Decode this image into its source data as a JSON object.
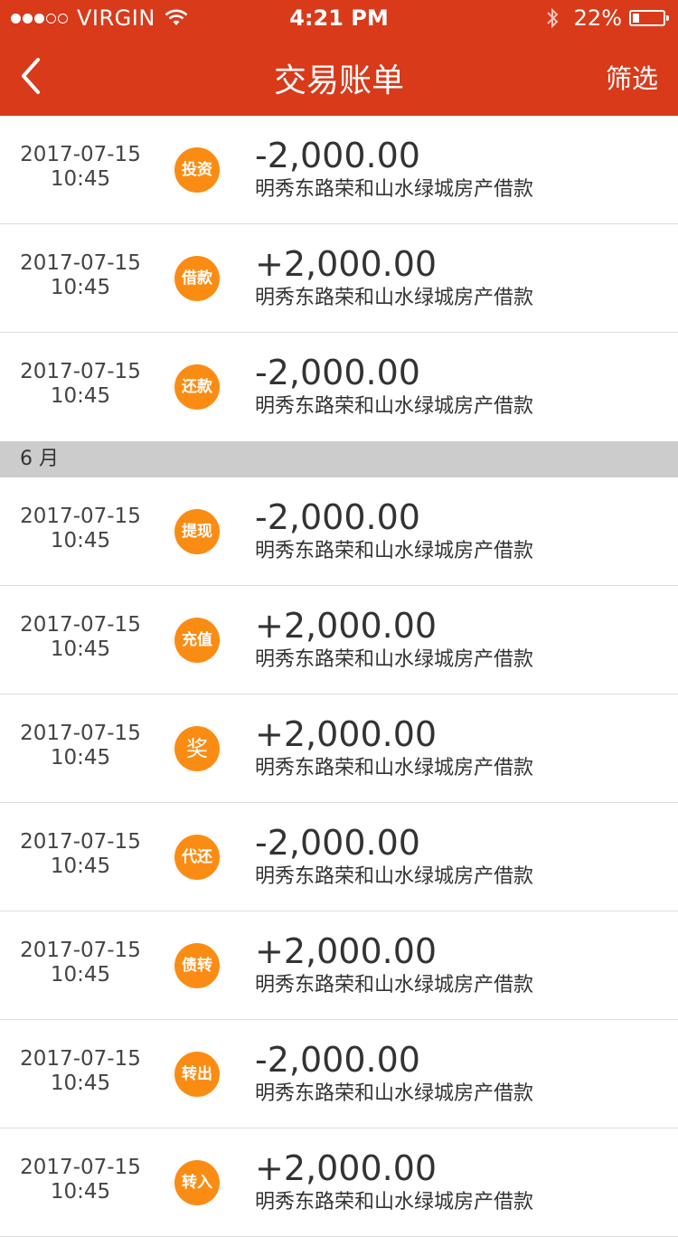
{
  "status_bar": {
    "carrier": "VIRGIN",
    "signal": {
      "filled": 3,
      "total": 5
    },
    "time": "4:21 PM",
    "battery_text": "22%",
    "battery_level": 0.22
  },
  "nav": {
    "title": "交易账单",
    "filter_label": "筛选"
  },
  "colors": {
    "header": "#d83a1a",
    "badge": "#fb8c13",
    "section": "#cccccc"
  },
  "transactions_top": [
    {
      "date": "2017-07-15",
      "time": "10:45",
      "badge": "投资",
      "amount": "-2,000.00",
      "desc": "明秀东路荣和山水绿城房产借款"
    },
    {
      "date": "2017-07-15",
      "time": "10:45",
      "badge": "借款",
      "amount": "+2,000.00",
      "desc": "明秀东路荣和山水绿城房产借款"
    },
    {
      "date": "2017-07-15",
      "time": "10:45",
      "badge": "还款",
      "amount": "-2,000.00",
      "desc": "明秀东路荣和山水绿城房产借款"
    }
  ],
  "section_label": "6 月",
  "transactions_june": [
    {
      "date": "2017-07-15",
      "time": "10:45",
      "badge": "提现",
      "amount": "-2,000.00",
      "desc": "明秀东路荣和山水绿城房产借款"
    },
    {
      "date": "2017-07-15",
      "time": "10:45",
      "badge": "充值",
      "amount": "+2,000.00",
      "desc": "明秀东路荣和山水绿城房产借款"
    },
    {
      "date": "2017-07-15",
      "time": "10:45",
      "badge": "奖",
      "amount": "+2,000.00",
      "desc": "明秀东路荣和山水绿城房产借款"
    },
    {
      "date": "2017-07-15",
      "time": "10:45",
      "badge": "代还",
      "amount": "-2,000.00",
      "desc": "明秀东路荣和山水绿城房产借款"
    },
    {
      "date": "2017-07-15",
      "time": "10:45",
      "badge": "债转",
      "amount": "+2,000.00",
      "desc": "明秀东路荣和山水绿城房产借款"
    },
    {
      "date": "2017-07-15",
      "time": "10:45",
      "badge": "转出",
      "amount": "-2,000.00",
      "desc": "明秀东路荣和山水绿城房产借款"
    },
    {
      "date": "2017-07-15",
      "time": "10:45",
      "badge": "转入",
      "amount": "+2,000.00",
      "desc": "明秀东路荣和山水绿城房产借款"
    }
  ]
}
